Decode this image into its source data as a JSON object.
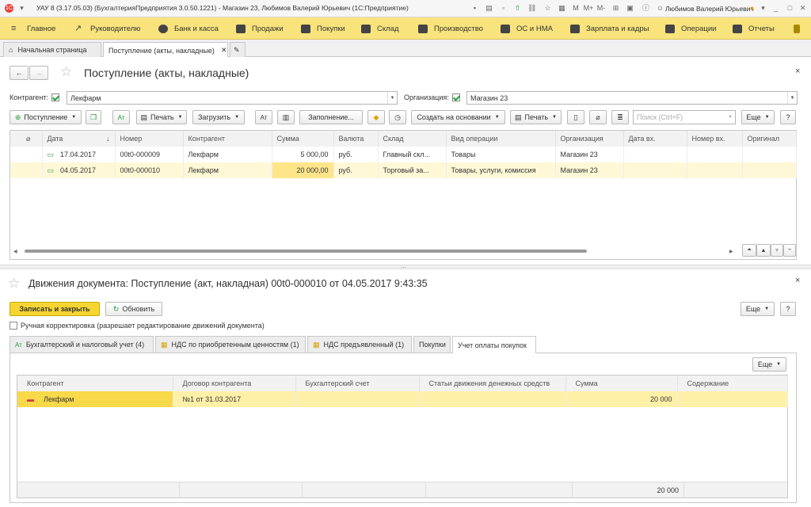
{
  "window": {
    "title": "УАУ 8 (3.17.05.03) (БухгалтерияПредприятия 3.0.50.1221) - Магазин 23, Любимов Валерий Юрьевич  (1С:Предприятие)",
    "user": "Любимов Валерий Юрьевич"
  },
  "menu": [
    "Главное",
    "Руководителю",
    "Банк и касса",
    "Продажи",
    "Покупки",
    "Склад",
    "Производство",
    "ОС и НМА",
    "Зарплата и кадры",
    "Операции",
    "Отчеты"
  ],
  "tabs": {
    "home": "Начальная страница",
    "doc": "Поступление (акты, накладные)"
  },
  "list": {
    "title": "Поступление (акты, накладные)",
    "kontragent_label": "Контрагент:",
    "kontragent_value": "Лекфарм",
    "org_label": "Организация:",
    "org_value": "Магазин 23",
    "toolbar": {
      "postuplenie": "Поступление",
      "pechat1": "Печать",
      "zagruzit": "Загрузить",
      "zapolnenie": "Заполнение...",
      "sozdat": "Создать на основании",
      "pechat2": "Печать",
      "search_placeholder": "Поиск (Ctrl+F)",
      "eshe": "Еще",
      "help": "?"
    },
    "columns": [
      "Дата",
      "Номер",
      "Контрагент",
      "Сумма",
      "Валюта",
      "Склад",
      "Вид операции",
      "Организация",
      "Дата вх.",
      "Номер вх.",
      "Оригинал"
    ],
    "rows": [
      {
        "date": "17.04.2017",
        "number": "00t0-000009",
        "kontragent": "Лекфарм",
        "summa": "5 000,00",
        "valuta": "руб.",
        "sklad": "Главный скл...",
        "vid": "Товары",
        "org": "Магазин 23",
        "date_vh": "",
        "num_vh": "",
        "orig": ""
      },
      {
        "date": "04.05.2017",
        "number": "00t0-000010",
        "kontragent": "Лекфарм",
        "summa": "20 000,00",
        "valuta": "руб.",
        "sklad": "Торговый за...",
        "vid": "Товары, услуги, комиссия",
        "org": "Магазин 23",
        "date_vh": "",
        "num_vh": "",
        "orig": ""
      }
    ]
  },
  "movements": {
    "title": "Движения документа: Поступление (акт, накладная) 00t0-000010 от 04.05.2017 9:43:35",
    "save_close": "Записать и закрыть",
    "refresh": "Обновить",
    "eshe": "Еще",
    "help": "?",
    "manual_label": "Ручная корректировка (разрешает редактирование движений документа)",
    "tabs": [
      "Бухгалтерский и налоговый учет (4)",
      "НДС по приобретенным ценностям (1)",
      "НДС предъявленный (1)",
      "Покупки",
      "Учет оплаты покупок"
    ],
    "inner_eshe": "Еще",
    "columns": [
      "Контрагент",
      "Договор контрагента",
      "Бухгалтерский счет",
      "Статьи движения денежных средств",
      "Сумма",
      "Содержание"
    ],
    "row": {
      "kontragent": "Лекфарм",
      "dogovor": "№1 от 31.03.2017",
      "schet": "",
      "statya": "",
      "summa": "20 000",
      "soderzhanie": ""
    },
    "total": "20 000"
  }
}
